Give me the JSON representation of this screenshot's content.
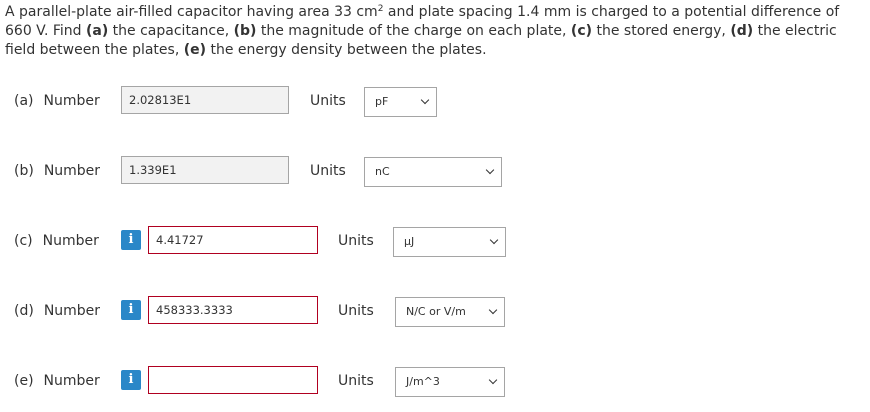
{
  "question": {
    "t1": "A parallel-plate air-filled capacitor having area 33 cm",
    "sup": "2",
    "t2": " and plate spacing 1.4 mm is charged to a potential difference of 660 V. Find ",
    "a": "(a)",
    "t3": " the capacitance, ",
    "b": "(b)",
    "t4": " the magnitude of the charge on each plate, ",
    "c": "(c)",
    "t5": " the stored energy, ",
    "d": "(d)",
    "t6": " the electric field between the plates, ",
    "e": "(e)",
    "t7": " the energy density between the plates."
  },
  "number_word": "Number",
  "units_word": "Units",
  "info_symbol": "i",
  "parts": [
    {
      "label": "(a)",
      "value": "2.02813E1",
      "units": "pF",
      "info": false
    },
    {
      "label": "(b)",
      "value": "1.339E1",
      "units": "nC",
      "info": false
    },
    {
      "label": "(c)",
      "value": "4.41727",
      "units": "μJ",
      "info": true
    },
    {
      "label": "(d)",
      "value": "458333.3333",
      "units": "N/C or V/m",
      "info": true
    },
    {
      "label": "(e)",
      "value": "",
      "units": "J/m^3",
      "info": true
    }
  ],
  "colors": {
    "info_icon": "#2a87c8",
    "error_border": "#b00020",
    "readonly_fill": "#f2f2f2"
  }
}
